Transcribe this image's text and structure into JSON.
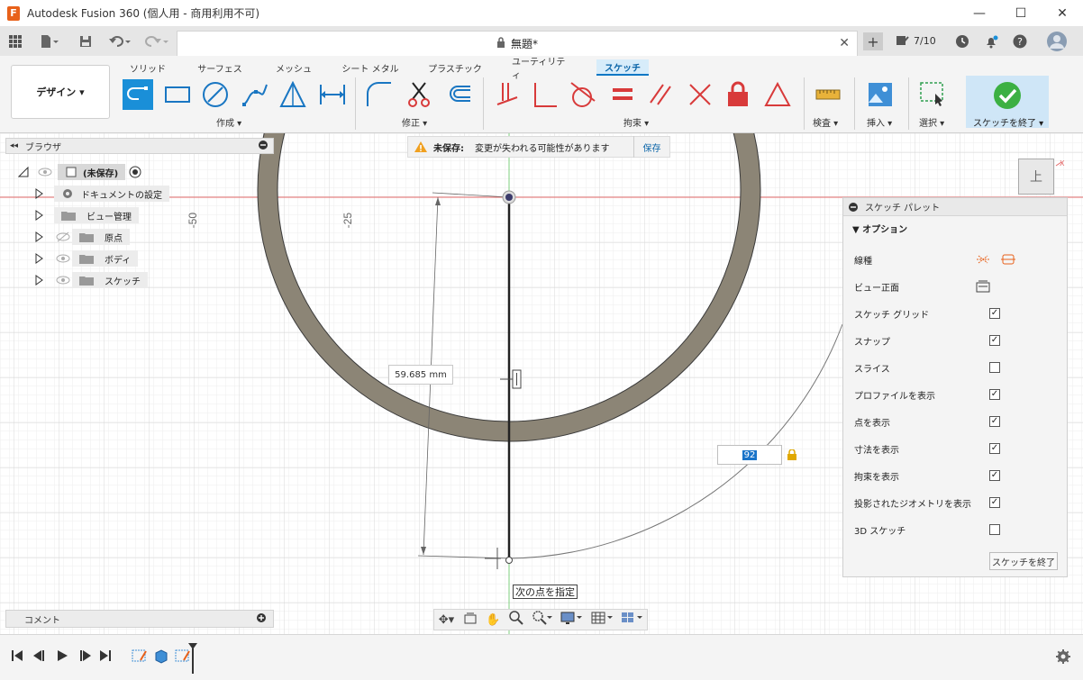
{
  "window": {
    "title": "Autodesk Fusion 360 (個人用 - 商用利用不可)",
    "icon_letter": "F",
    "minimize": "—",
    "maximize": "☐",
    "close": "✕"
  },
  "quickbar": {
    "doc_title": "無題*",
    "tab_close": "✕",
    "new_tab": "+",
    "job_status": "7/10"
  },
  "ribbon": {
    "workspace": "デザイン ▾",
    "tabs": [
      "ソリッド",
      "サーフェス",
      "メッシュ",
      "シート メタル",
      "プラスチック",
      "ユーティリティ",
      "スケッチ"
    ],
    "groups": {
      "create": "作成 ▾",
      "modify": "修正 ▾",
      "constraints": "拘束 ▾",
      "inspect": "検査 ▾",
      "insert": "挿入 ▾",
      "select": "選択 ▾",
      "finish": "スケッチを終了 ▾"
    }
  },
  "browser": {
    "title": "ブラウザ",
    "root": "(未保存)",
    "items": [
      "ドキュメントの設定",
      "ビュー管理",
      "原点",
      "ボディ",
      "スケッチ"
    ]
  },
  "comments": {
    "title": "コメント"
  },
  "banner": {
    "label": "未保存:",
    "message": "変更が失われる可能性があります",
    "save": "保存"
  },
  "canvas": {
    "ruler_labels": [
      "-50",
      "-25"
    ],
    "dimension": "59.685 mm",
    "input_value": "92",
    "tooltip": "次の点を指定",
    "viewcube": "上"
  },
  "palette": {
    "title": "スケッチ パレット",
    "section": "▼ オプション",
    "rows": [
      {
        "label": "線種",
        "type": "icons"
      },
      {
        "label": "ビュー正面",
        "type": "icon"
      },
      {
        "label": "スケッチ グリッド",
        "checked": true
      },
      {
        "label": "スナップ",
        "checked": true
      },
      {
        "label": "スライス",
        "checked": false
      },
      {
        "label": "プロファイルを表示",
        "checked": true
      },
      {
        "label": "点を表示",
        "checked": true
      },
      {
        "label": "寸法を表示",
        "checked": true
      },
      {
        "label": "拘束を表示",
        "checked": true
      },
      {
        "label": "投影されたジオメトリを表示",
        "checked": true
      },
      {
        "label": "3D スケッチ",
        "checked": false
      }
    ],
    "finish_button": "スケッチを終了"
  },
  "colors": {
    "accent": "#1a8fd8",
    "ring": "#8c8576",
    "constraint_red": "#d83a3a"
  }
}
